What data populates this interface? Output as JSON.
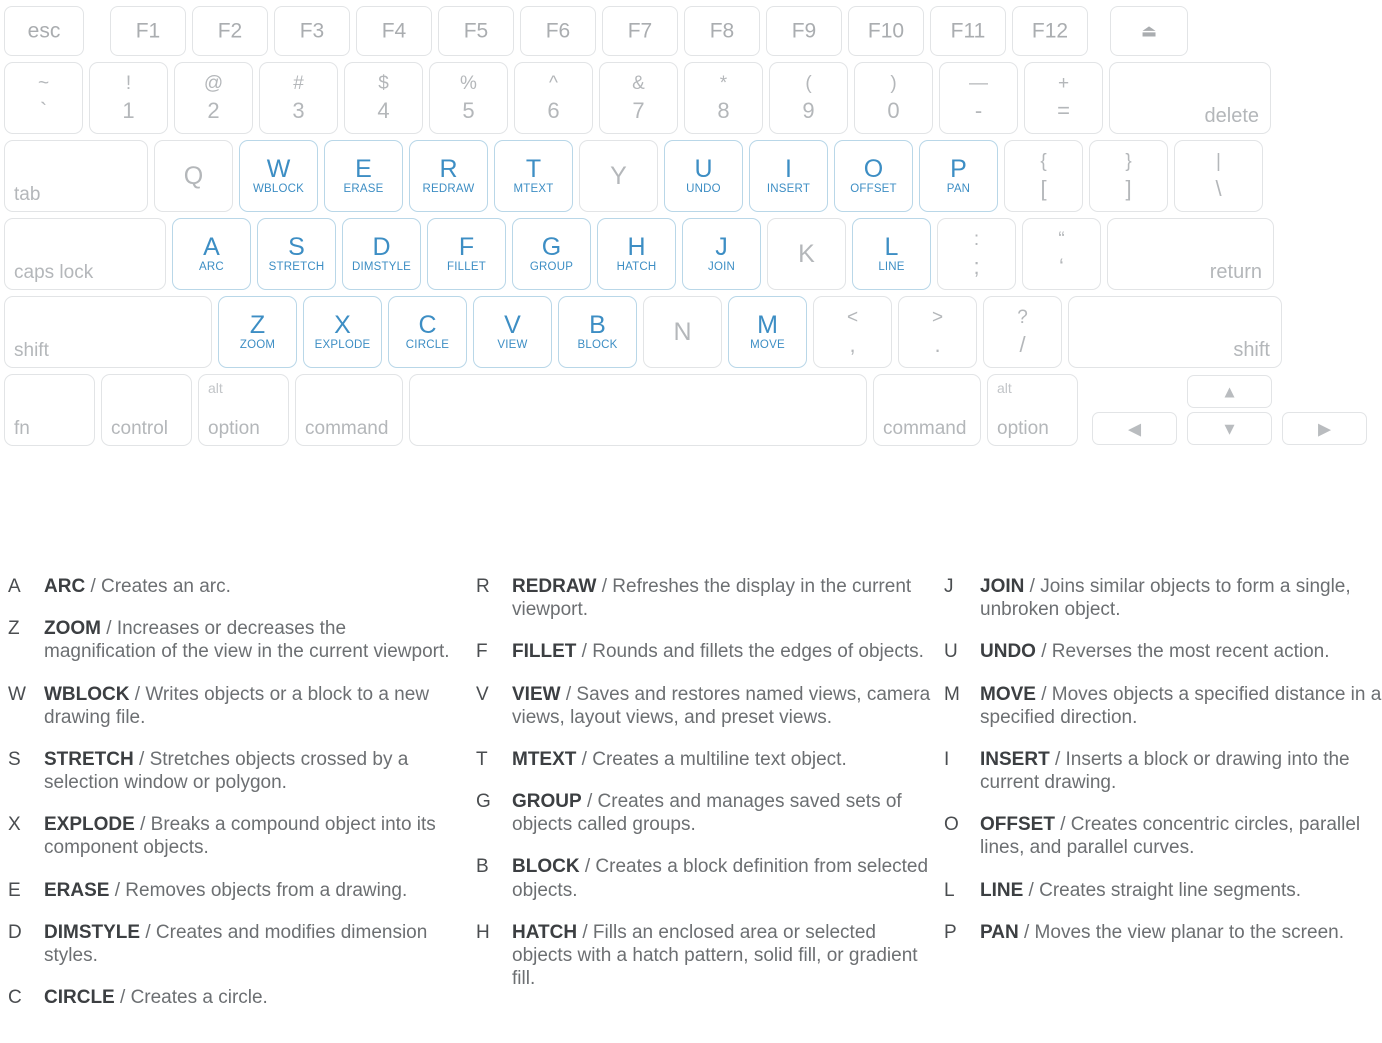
{
  "colors": {
    "accent_blue": "#3d8ec4",
    "key_border": "#e2e4e6",
    "key_border_active": "#b9d7e8",
    "inactive_text": "#b4b7ba",
    "legend_key": "#4a4d50",
    "legend_command": "#3c3f42",
    "legend_desc": "#6c6f72",
    "background": "#ffffff"
  },
  "keyboard": {
    "function_row": [
      {
        "label": "esc"
      },
      {
        "label": "F1"
      },
      {
        "label": "F2"
      },
      {
        "label": "F3"
      },
      {
        "label": "F4"
      },
      {
        "label": "F5"
      },
      {
        "label": "F6"
      },
      {
        "label": "F7"
      },
      {
        "label": "F8"
      },
      {
        "label": "F9"
      },
      {
        "label": "F10"
      },
      {
        "label": "F11"
      },
      {
        "label": "F12"
      },
      {
        "label": "⏏",
        "icon": "eject-icon"
      }
    ],
    "number_row": [
      {
        "upper": "~",
        "lower": "`"
      },
      {
        "upper": "!",
        "lower": "1"
      },
      {
        "upper": "@",
        "lower": "2"
      },
      {
        "upper": "#",
        "lower": "3"
      },
      {
        "upper": "$",
        "lower": "4"
      },
      {
        "upper": "%",
        "lower": "5"
      },
      {
        "upper": "^",
        "lower": "6"
      },
      {
        "upper": "&",
        "lower": "7"
      },
      {
        "upper": "*",
        "lower": "8"
      },
      {
        "upper": "(",
        "lower": "9"
      },
      {
        "upper": ")",
        "lower": "0"
      },
      {
        "upper": "—",
        "lower": "-"
      },
      {
        "upper": "+",
        "lower": "="
      },
      {
        "label": "delete"
      }
    ],
    "tab_row": [
      {
        "label": "tab"
      },
      {
        "letter": "Q",
        "command": null
      },
      {
        "letter": "W",
        "command": "WBLOCK"
      },
      {
        "letter": "E",
        "command": "ERASE"
      },
      {
        "letter": "R",
        "command": "REDRAW"
      },
      {
        "letter": "T",
        "command": "MTEXT"
      },
      {
        "letter": "Y",
        "command": null
      },
      {
        "letter": "U",
        "command": "UNDO"
      },
      {
        "letter": "I",
        "command": "INSERT"
      },
      {
        "letter": "O",
        "command": "OFFSET"
      },
      {
        "letter": "P",
        "command": "PAN"
      },
      {
        "upper": "{",
        "lower": "["
      },
      {
        "upper": "}",
        "lower": "]"
      },
      {
        "upper": "|",
        "lower": "\\"
      }
    ],
    "caps_row": [
      {
        "label": "caps lock"
      },
      {
        "letter": "A",
        "command": "ARC"
      },
      {
        "letter": "S",
        "command": "STRETCH"
      },
      {
        "letter": "D",
        "command": "DIMSTYLE"
      },
      {
        "letter": "F",
        "command": "FILLET"
      },
      {
        "letter": "G",
        "command": "GROUP"
      },
      {
        "letter": "H",
        "command": "HATCH"
      },
      {
        "letter": "J",
        "command": "JOIN"
      },
      {
        "letter": "K",
        "command": null
      },
      {
        "letter": "L",
        "command": "LINE"
      },
      {
        "upper": ":",
        "lower": ";"
      },
      {
        "upper": "“",
        "lower": "‘"
      },
      {
        "label": "return"
      }
    ],
    "shift_row": [
      {
        "label": "shift"
      },
      {
        "letter": "Z",
        "command": "ZOOM"
      },
      {
        "letter": "X",
        "command": "EXPLODE"
      },
      {
        "letter": "C",
        "command": "CIRCLE"
      },
      {
        "letter": "V",
        "command": "VIEW"
      },
      {
        "letter": "B",
        "command": "BLOCK"
      },
      {
        "letter": "N",
        "command": null
      },
      {
        "letter": "M",
        "command": "MOVE"
      },
      {
        "upper": "<",
        "lower": ","
      },
      {
        "upper": ">",
        "lower": "."
      },
      {
        "upper": "?",
        "lower": "/"
      },
      {
        "label": "shift"
      }
    ],
    "bottom_row": {
      "fn": "fn",
      "control": "control",
      "option_left_alt": "alt",
      "option_left": "option",
      "command_left": "command",
      "space": "",
      "command_right": "command",
      "option_right_alt": "alt",
      "option_right": "option",
      "arrow_up": "▲",
      "arrow_left": "◀",
      "arrow_down": "▼",
      "arrow_right": "▶"
    }
  },
  "legend": {
    "column1": [
      {
        "key": "A",
        "command": "ARC",
        "desc": "/ Creates an arc."
      },
      {
        "key": "Z",
        "command": "ZOOM",
        "desc": "/ Increases or decreases the magnification of the view in the current viewport."
      },
      {
        "key": "W",
        "command": "WBLOCK",
        "desc": "/ Writes objects or a block to a new drawing file."
      },
      {
        "key": "S",
        "command": "STRETCH",
        "desc": "/ Stretches objects crossed by a selection window or polygon."
      },
      {
        "key": "X",
        "command": "EXPLODE",
        "desc": "/ Breaks a compound object into its component objects."
      },
      {
        "key": "E",
        "command": "ERASE",
        "desc": "/ Removes objects from a drawing."
      },
      {
        "key": "D",
        "command": "DIMSTYLE",
        "desc": "/ Creates and modifies dimension styles."
      },
      {
        "key": "C",
        "command": "CIRCLE",
        "desc": "/ Creates a circle."
      }
    ],
    "column2": [
      {
        "key": "R",
        "command": "REDRAW",
        "desc": "/ Refreshes the display in the current viewport."
      },
      {
        "key": "F",
        "command": "FILLET",
        "desc": "/ Rounds and fillets the edges of objects."
      },
      {
        "key": "V",
        "command": "VIEW",
        "desc": "/ Saves and restores named views, camera views, layout views, and preset views."
      },
      {
        "key": "T",
        "command": "MTEXT",
        "desc": "/ Creates a multiline text object."
      },
      {
        "key": "G",
        "command": "GROUP",
        "desc": "/ Creates and manages saved sets of objects called groups."
      },
      {
        "key": "B",
        "command": "BLOCK",
        "desc": "/ Creates a block definition from selected objects."
      },
      {
        "key": "H",
        "command": "HATCH",
        "desc": "/ Fills an enclosed area or selected objects with a hatch pattern, solid fill, or gradient fill."
      }
    ],
    "column3": [
      {
        "key": "J",
        "command": "JOIN",
        "desc": "/ Joins similar objects to form a single, unbroken object."
      },
      {
        "key": "U",
        "command": "UNDO",
        "desc": "/ Reverses the most recent action."
      },
      {
        "key": "M",
        "command": "MOVE",
        "desc": "/ Moves objects a specified distance in a specified direction."
      },
      {
        "key": "I",
        "command": "INSERT",
        "desc": "/ Inserts a block or drawing into the current drawing."
      },
      {
        "key": "O",
        "command": "OFFSET",
        "desc": "/ Creates concentric circles, parallel lines, and parallel curves."
      },
      {
        "key": "L",
        "command": "LINE",
        "desc": "/ Creates straight line segments."
      },
      {
        "key": "P",
        "command": "PAN",
        "desc": "/ Moves the view planar to the screen."
      }
    ]
  }
}
